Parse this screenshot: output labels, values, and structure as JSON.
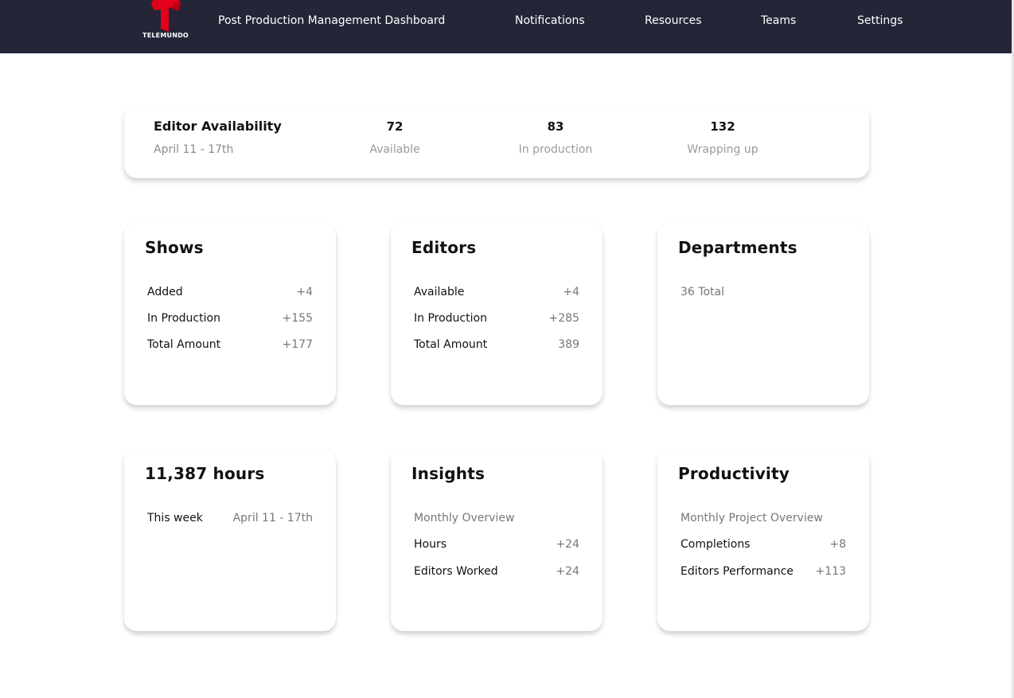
{
  "brand": {
    "logo_text": "TELEMUNDO",
    "logo_color": "#e3001b"
  },
  "nav": {
    "title": "Post Production Management Dashboard",
    "links": [
      "Notifications",
      "Resources",
      "Teams",
      "Settings"
    ]
  },
  "summary": {
    "title": "Editor Availability",
    "date_range": "April 11 - 17th",
    "stats": [
      {
        "value": "72",
        "label": "Available"
      },
      {
        "value": "83",
        "label": "In production"
      },
      {
        "value": "132",
        "label": "Wrapping up"
      }
    ]
  },
  "shows": {
    "title": "Shows",
    "rows": [
      {
        "label": "Added",
        "value": "+4"
      },
      {
        "label": "In Production",
        "value": "+155"
      },
      {
        "label": "Total Amount",
        "value": "+177"
      }
    ]
  },
  "editors": {
    "title": "Editors",
    "rows": [
      {
        "label": "Available",
        "value": "+4"
      },
      {
        "label": "In Production",
        "value": "+285"
      },
      {
        "label": "Total Amount",
        "value": "389"
      }
    ]
  },
  "departments": {
    "title": "Departments",
    "total": "36 Total"
  },
  "hours": {
    "title": "11,387 hours",
    "row": {
      "label": "This week",
      "value": "April 11 - 17th"
    }
  },
  "insights": {
    "title": "Insights",
    "subtitle": "Monthly Overview",
    "rows": [
      {
        "label": "Hours",
        "value": "+24"
      },
      {
        "label": "Editors Worked",
        "value": "+24"
      }
    ]
  },
  "productivity": {
    "title": "Productivity",
    "subtitle": "Monthly Project Overview",
    "rows": [
      {
        "label": "Completions",
        "value": "+8"
      },
      {
        "label": "Editors Performance",
        "value": "+113"
      }
    ]
  },
  "colors": {
    "navbar_bg": "#242638",
    "muted_text": "#8a8a8a"
  }
}
